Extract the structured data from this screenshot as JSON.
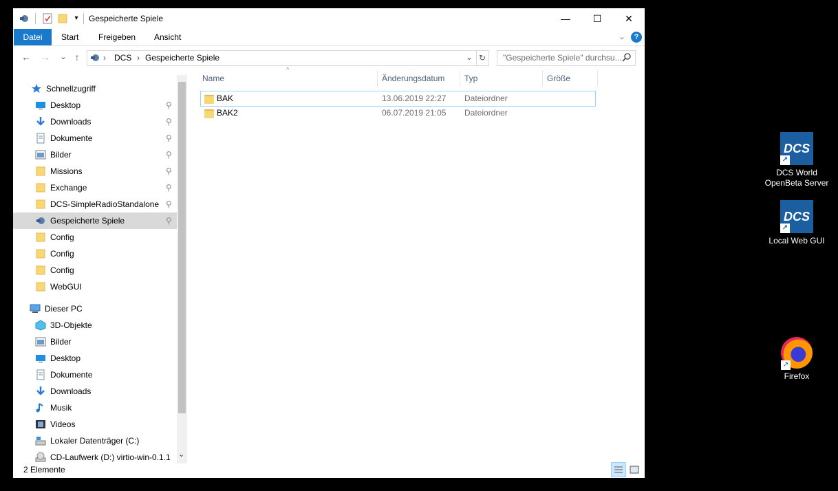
{
  "window": {
    "title": "Gespeicherte Spiele",
    "controls": {
      "minimize": "—",
      "maximize": "☐",
      "close": "✕"
    }
  },
  "ribbon": {
    "tabs": [
      "Datei",
      "Start",
      "Freigeben",
      "Ansicht"
    ],
    "help": "?",
    "expand": "⌄"
  },
  "address": {
    "back": "←",
    "forward": "→",
    "recent": "⌄",
    "up": "↑",
    "path": [
      "DCS",
      "Gespeicherte Spiele"
    ],
    "separator": "›",
    "refresh": "↻",
    "search_placeholder": "\"Gespeicherte Spiele\" durchsu..."
  },
  "sidebar": {
    "quick_access": "Schnellzugriff",
    "quick_items": [
      {
        "label": "Desktop",
        "icon": "desktop-icon"
      },
      {
        "label": "Downloads",
        "icon": "downloads-icon"
      },
      {
        "label": "Dokumente",
        "icon": "documents-icon"
      },
      {
        "label": "Bilder",
        "icon": "pictures-icon"
      },
      {
        "label": "Missions",
        "icon": "folder-icon"
      },
      {
        "label": "Exchange",
        "icon": "folder-icon"
      },
      {
        "label": "DCS-SimpleRadioStandalone",
        "icon": "folder-icon"
      },
      {
        "label": "Gespeicherte Spiele",
        "icon": "saved-games-icon"
      },
      {
        "label": "Config",
        "icon": "folder-icon"
      },
      {
        "label": "Config",
        "icon": "folder-icon"
      },
      {
        "label": "Config",
        "icon": "folder-icon"
      },
      {
        "label": "WebGUI",
        "icon": "folder-icon"
      }
    ],
    "this_pc": "Dieser PC",
    "pc_items": [
      {
        "label": "3D-Objekte",
        "icon": "3d-objects-icon"
      },
      {
        "label": "Bilder",
        "icon": "pictures-icon"
      },
      {
        "label": "Desktop",
        "icon": "desktop-icon"
      },
      {
        "label": "Dokumente",
        "icon": "documents-icon"
      },
      {
        "label": "Downloads",
        "icon": "downloads-icon"
      },
      {
        "label": "Musik",
        "icon": "music-icon"
      },
      {
        "label": "Videos",
        "icon": "videos-icon"
      },
      {
        "label": "Lokaler Datenträger (C:)",
        "icon": "drive-icon"
      },
      {
        "label": "CD-Laufwerk (D:) virtio-win-0.1.1",
        "icon": "cd-drive-icon"
      }
    ]
  },
  "columns": {
    "name": "Name",
    "date": "Änderungsdatum",
    "type": "Typ",
    "size": "Größe",
    "sort_arrow": "^"
  },
  "files": [
    {
      "name": "BAK",
      "date": "13.06.2019 22:27",
      "type": "Dateiordner",
      "size": ""
    },
    {
      "name": "BAK2",
      "date": "06.07.2019 21:05",
      "type": "Dateiordner",
      "size": ""
    }
  ],
  "status": {
    "count": "2 Elemente"
  },
  "desktop": [
    {
      "label": "DCS World OpenBeta Server",
      "icon": "dcs-icon",
      "logo": "DCS"
    },
    {
      "label": "Local Web GUI",
      "icon": "dcs-icon",
      "logo": "DCS"
    },
    {
      "label": "Firefox",
      "icon": "firefox-icon"
    }
  ],
  "colors": {
    "accent": "#1979ca",
    "selected": "#d9d9d9",
    "folder": "#f8d775",
    "header_text": "#4c607a"
  }
}
